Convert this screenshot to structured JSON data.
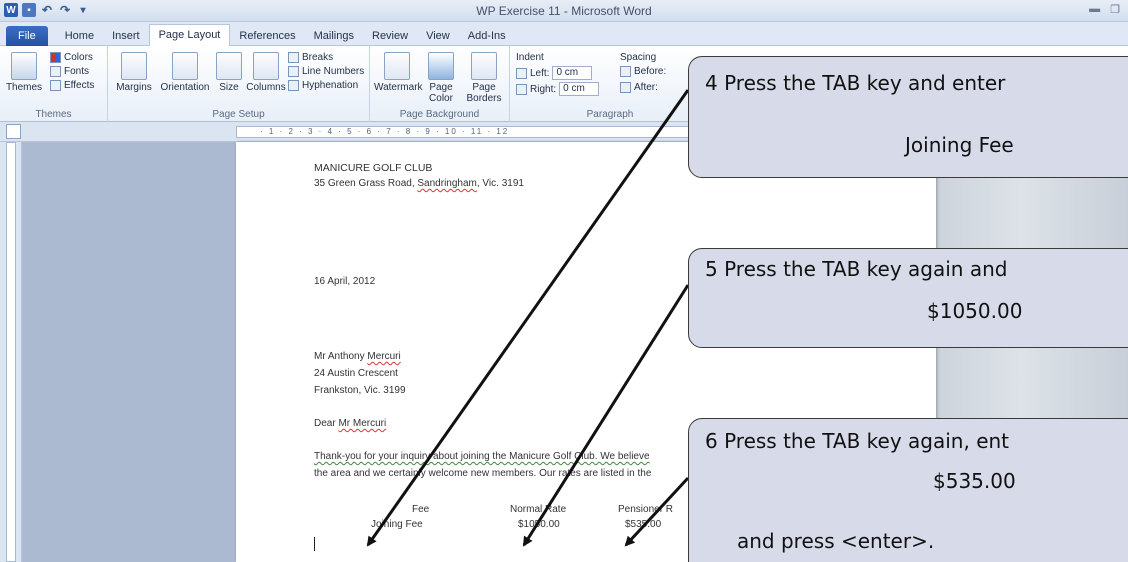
{
  "window": {
    "title": "WP Exercise 11  -  Microsoft Word"
  },
  "tabs": [
    "File",
    "Home",
    "Insert",
    "Page Layout",
    "References",
    "Mailings",
    "Review",
    "View",
    "Add-Ins"
  ],
  "ribbon": {
    "themes": {
      "themes_label": "Themes",
      "colors": "Colors",
      "fonts": "Fonts",
      "effects": "Effects",
      "group": "Themes"
    },
    "page_setup": {
      "margins": "Margins",
      "orientation": "Orientation",
      "size": "Size",
      "columns": "Columns",
      "breaks": "Breaks",
      "line_numbers": "Line Numbers",
      "hyphenation": "Hyphenation",
      "group": "Page Setup"
    },
    "page_background": {
      "watermark": "Watermark",
      "page_color": "Page Color",
      "page_borders": "Page Borders",
      "group": "Page Background"
    },
    "paragraph": {
      "indent": "Indent",
      "left": "Left:",
      "left_value": "0 cm",
      "right": "Right:",
      "right_value": "0 cm",
      "spacing": "Spacing",
      "before": "Before:",
      "after": "After:",
      "group": "Paragraph"
    }
  },
  "document": {
    "club_name": "MANICURE GOLF CLUB",
    "address_prefix": "35 Green Grass Road, ",
    "address_suburb": "Sandringham",
    "address_suffix": ", Vic. 3191",
    "date": "16 April, 2012",
    "recipient_prefix": "Mr Anthony ",
    "recipient_surname": "Mercuri",
    "recipient_street": "24 Austin Crescent",
    "recipient_city": "Frankston, Vic. 3199",
    "salutation_prefix": "Dear ",
    "salutation_name": "Mr Mercuri",
    "body_line1": "Thank-you for your inquiry about joining the Manicure Golf Club.  We believe",
    "body_line2": "the area and we certainly welcome new members.  Our rates are listed in the",
    "table_headers": [
      "Fee",
      "Normal Rate",
      "Pensioner R"
    ],
    "table_row": [
      "Joining Fee",
      "$1050.00",
      "$535.00"
    ]
  },
  "callouts": [
    {
      "line1": "4 Press the TAB key and enter",
      "line2": "Joining Fee"
    },
    {
      "line1": "5 Press the TAB key again and",
      "line2": "$1050.00"
    },
    {
      "line1": "6 Press the TAB key again, ent",
      "line2": "$535.00",
      "line3": "and press <enter>."
    }
  ]
}
